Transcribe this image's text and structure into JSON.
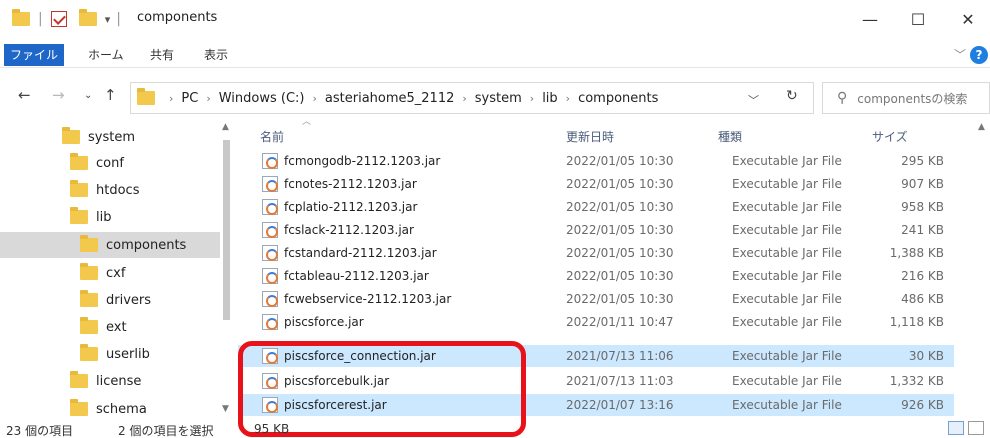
{
  "window": {
    "title": "components",
    "minimize": "—",
    "maximize": "☐",
    "close": "✕"
  },
  "ribbon": {
    "tabs": [
      "ファイル",
      "ホーム",
      "共有",
      "表示"
    ],
    "help": "?"
  },
  "address": {
    "crumbs": [
      "PC",
      "Windows (C:)",
      "asteriahome5_2112",
      "system",
      "lib",
      "components"
    ],
    "search_placeholder": "componentsの検索"
  },
  "nav": {
    "items": [
      {
        "label": "system",
        "indent": 0,
        "selected": false
      },
      {
        "label": "conf",
        "indent": 1,
        "selected": false
      },
      {
        "label": "htdocs",
        "indent": 1,
        "selected": false
      },
      {
        "label": "lib",
        "indent": 1,
        "selected": false
      },
      {
        "label": "components",
        "indent": 2,
        "selected": true
      },
      {
        "label": "cxf",
        "indent": 2,
        "selected": false
      },
      {
        "label": "drivers",
        "indent": 2,
        "selected": false
      },
      {
        "label": "ext",
        "indent": 2,
        "selected": false
      },
      {
        "label": "userlib",
        "indent": 2,
        "selected": false
      },
      {
        "label": "license",
        "indent": 1,
        "selected": false
      },
      {
        "label": "schema",
        "indent": 1,
        "selected": false
      }
    ]
  },
  "list": {
    "columns": {
      "name": "名前",
      "date": "更新日時",
      "type": "種類",
      "size": "サイズ"
    },
    "files": [
      {
        "name": "fcmongodb-2112.1203.jar",
        "date": "2022/01/05 10:30",
        "type": "Executable Jar File",
        "size": "295 KB",
        "selected": false
      },
      {
        "name": "fcnotes-2112.1203.jar",
        "date": "2022/01/05 10:30",
        "type": "Executable Jar File",
        "size": "907 KB",
        "selected": false
      },
      {
        "name": "fcplatio-2112.1203.jar",
        "date": "2022/01/05 10:30",
        "type": "Executable Jar File",
        "size": "958 KB",
        "selected": false
      },
      {
        "name": "fcslack-2112.1203.jar",
        "date": "2022/01/05 10:30",
        "type": "Executable Jar File",
        "size": "241 KB",
        "selected": false
      },
      {
        "name": "fcstandard-2112.1203.jar",
        "date": "2022/01/05 10:30",
        "type": "Executable Jar File",
        "size": "1,388 KB",
        "selected": false
      },
      {
        "name": "fctableau-2112.1203.jar",
        "date": "2022/01/05 10:30",
        "type": "Executable Jar File",
        "size": "216 KB",
        "selected": false
      },
      {
        "name": "fcwebservice-2112.1203.jar",
        "date": "2022/01/05 10:30",
        "type": "Executable Jar File",
        "size": "486 KB",
        "selected": false
      },
      {
        "name": "piscsforce.jar",
        "date": "2022/01/11 10:47",
        "type": "Executable Jar File",
        "size": "1,118 KB",
        "selected": false
      },
      {
        "name": "piscsforce_connection.jar",
        "date": "2021/07/13 11:06",
        "type": "Executable Jar File",
        "size": "30 KB",
        "selected": true
      },
      {
        "name": "piscsforcebulk.jar",
        "date": "2021/07/13 11:03",
        "type": "Executable Jar File",
        "size": "1,332 KB",
        "selected": false
      },
      {
        "name": "piscsforcerest.jar",
        "date": "2022/01/07 13:16",
        "type": "Executable Jar File",
        "size": "926 KB",
        "selected": true
      }
    ]
  },
  "status": {
    "item_count": "23 個の項目",
    "selected_count": "2 個の項目を選択",
    "selected_size": "95 KB"
  },
  "colors": {
    "accent": "#1e66c8",
    "selection": "#cce8ff",
    "highlight": "#e8131a"
  }
}
